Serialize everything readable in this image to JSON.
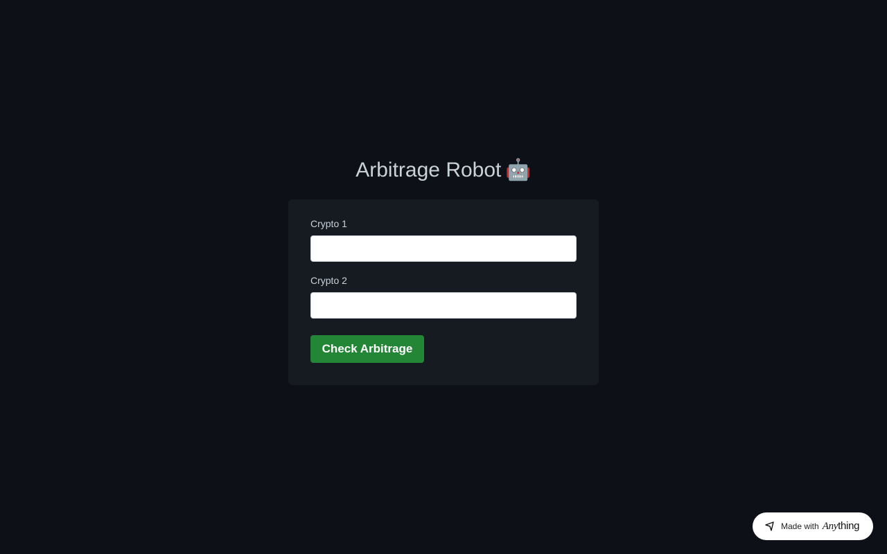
{
  "page": {
    "title": "Arbitrage Robot",
    "title_emoji": "🤖"
  },
  "form": {
    "crypto1": {
      "label": "Crypto 1",
      "value": "",
      "placeholder": ""
    },
    "crypto2": {
      "label": "Crypto 2",
      "value": "",
      "placeholder": ""
    },
    "submit_label": "Check Arbitrage"
  },
  "badge": {
    "made_with": "Made with",
    "brand_any": "Any",
    "brand_thing": "thing",
    "icon": "anything-logo-icon"
  },
  "colors": {
    "background": "#0d1117",
    "card": "#161b22",
    "button": "#238636",
    "text": "#c9d1d9"
  }
}
